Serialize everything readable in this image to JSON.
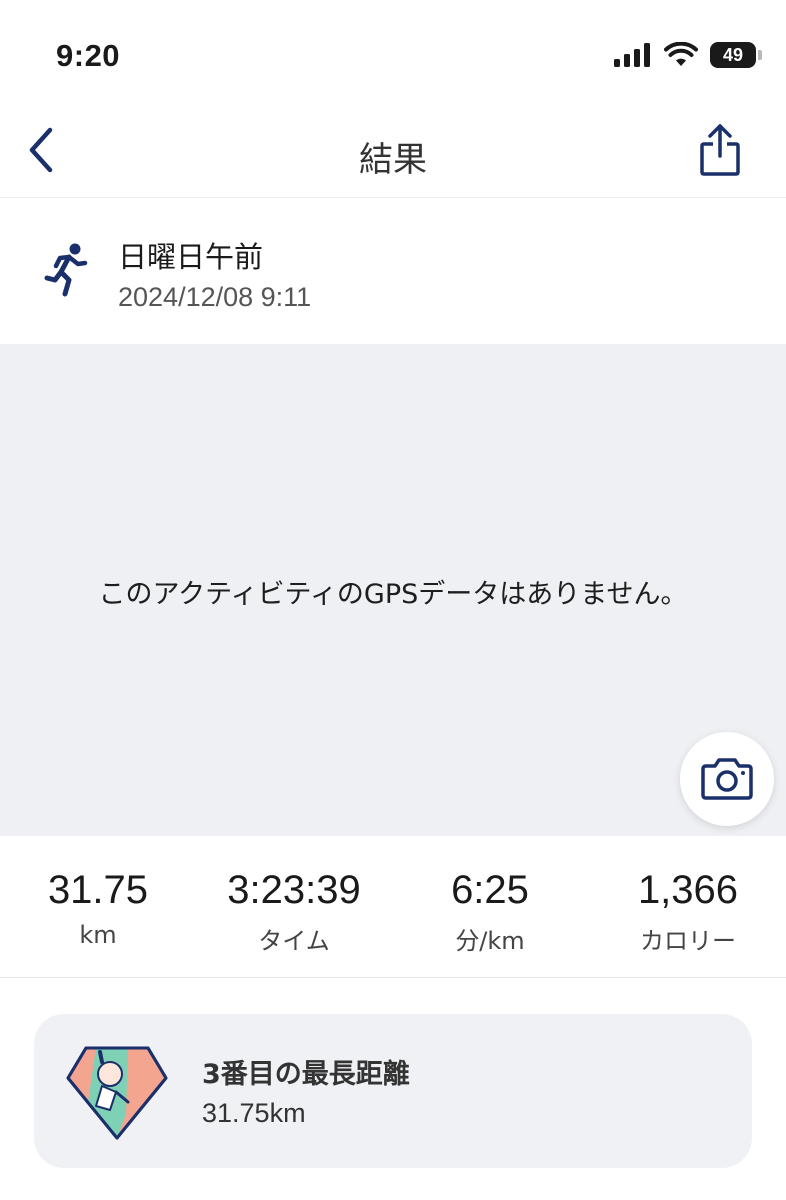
{
  "status_bar": {
    "time": "9:20",
    "battery": "49",
    "icons": [
      "cellular-signal-icon",
      "wifi-icon",
      "battery-icon"
    ]
  },
  "nav": {
    "title": "結果",
    "back_icon": "chevron-left-icon",
    "share_icon": "share-icon"
  },
  "activity": {
    "name": "日曜日午前",
    "datetime": "2024/12/08 9:11",
    "icon": "running-person-icon"
  },
  "map": {
    "message": "このアクティビティのGPSデータはありません。",
    "camera_icon": "camera-icon"
  },
  "stats": [
    {
      "value": "31.75",
      "label": "km"
    },
    {
      "value": "3:23:39",
      "label": "タイム"
    },
    {
      "value": "6:25",
      "label": "分/km"
    },
    {
      "value": "1,366",
      "label": "カロリー"
    }
  ],
  "record": {
    "title": "3番目の最長距離",
    "value": "31.75km",
    "badge_icon": "achievement-badge-icon"
  },
  "colors": {
    "accent": "#1b2f6b",
    "map_bg": "#eef0f3",
    "card_bg": "#eff1f4"
  }
}
